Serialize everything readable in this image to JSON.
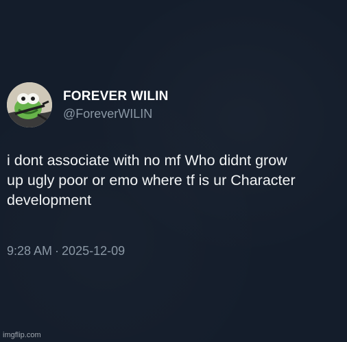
{
  "tweet": {
    "author": {
      "display_name": "FOREVER WILIN",
      "handle": "@ForeverWILIN",
      "avatar_icon": "kermit-frog-avatar-icon"
    },
    "text": "i dont associate with no mf Who didnt grow\nup ugly poor or emo where tf is ur Character\ndevelopment",
    "time": "9:28 AM",
    "separator": "·",
    "date": "2025-12-09"
  },
  "watermark": "imgflip.com",
  "colors": {
    "background": "#141d2b",
    "text_primary": "#f1f3f4",
    "text_secondary": "#8b98a5"
  }
}
